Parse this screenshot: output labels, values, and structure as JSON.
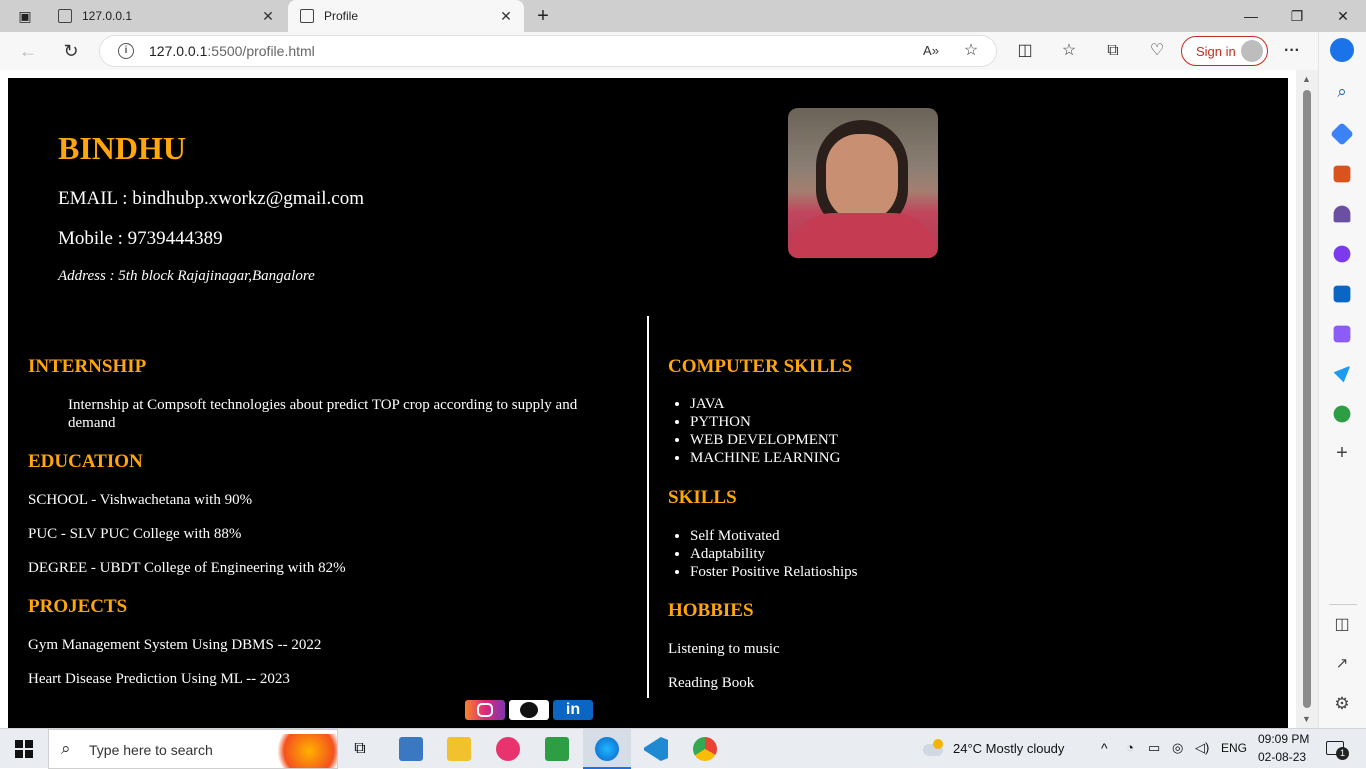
{
  "browser": {
    "tabs": [
      {
        "label": "127.0.0.1",
        "active": false
      },
      {
        "label": "Profile",
        "active": true
      }
    ],
    "url_host": "127.0.0.1",
    "url_rest": ":5500/profile.html",
    "signin_label": "Sign in"
  },
  "profile": {
    "name": "BINDHU",
    "email": "EMAIL : bindhubp.xworkz@gmail.com",
    "mobile": "Mobile : 9739444389",
    "address": "Address : 5th block Rajajinagar,Bangalore"
  },
  "left": {
    "internship_heading": "INTERNSHIP",
    "internship_text": "Internship at Compsoft technologies about predict TOP crop according to supply and demand",
    "education_heading": "EDUCATION",
    "education": [
      "SCHOOL - Vishwachetana with 90%",
      "PUC - SLV PUC College with 88%",
      "DEGREE - UBDT College of Engineering with 82%"
    ],
    "projects_heading": "PROJECTS",
    "projects": [
      "Gym Management System Using DBMS -- 2022",
      "Heart Disease Prediction Using ML -- 2023"
    ]
  },
  "right": {
    "computer_skills_heading": "COMPUTER SKILLS",
    "computer_skills": [
      "JAVA",
      "PYTHON",
      "WEB DEVELOPMENT",
      "MACHINE LEARNING"
    ],
    "skills_heading": "SKILLS",
    "skills": [
      "Self Motivated",
      "Adaptability",
      "Foster Positive Relatioships"
    ],
    "hobbies_heading": "HOBBIES",
    "hobbies": [
      "Listening to music",
      "Reading Book"
    ]
  },
  "colors": {
    "accent": "#ffa60d",
    "page_bg": "#000000"
  },
  "taskbar": {
    "search_placeholder": "Type here to search",
    "weather": "24°C  Mostly cloudy",
    "lang": "ENG",
    "time": "09:09 PM",
    "date": "02-08-23",
    "notification_count": "1"
  }
}
